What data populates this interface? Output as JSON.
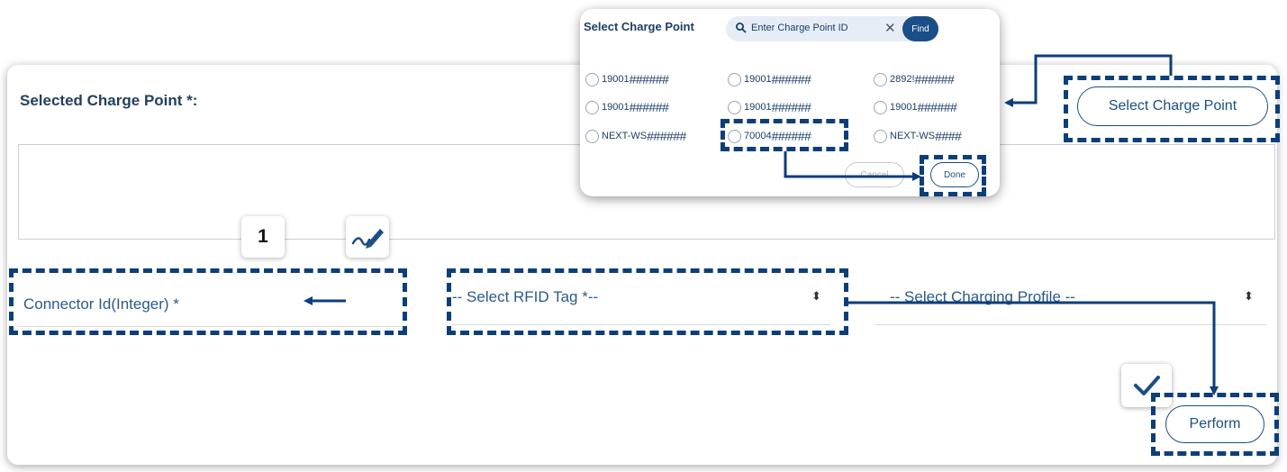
{
  "main": {
    "selected_label": "Selected Charge Point *:",
    "select_button": "Select Charge Point",
    "connector_label": "Connector Id(Integer) *",
    "connector_value": "1",
    "rfid_placeholder": "-- Select RFID Tag *--",
    "profile_placeholder": "-- Select Charging Profile --",
    "perform_button": "Perform",
    "select_arrows": "⬍"
  },
  "popup": {
    "title": "Select Charge Point",
    "search_placeholder": "Enter Charge Point ID",
    "clear_glyph": "✕",
    "find_button": "Find",
    "options": [
      {
        "prefix": "19001",
        "mask": "######"
      },
      {
        "prefix": "19001",
        "mask": "######"
      },
      {
        "prefix": "2892!",
        "mask": "######"
      },
      {
        "prefix": "19001",
        "mask": "######"
      },
      {
        "prefix": "19001",
        "mask": "######"
      },
      {
        "prefix": "19001",
        "mask": "######"
      },
      {
        "prefix": "NEXT-WS",
        "mask": "######"
      },
      {
        "prefix": "70004",
        "mask": "######"
      },
      {
        "prefix": "NEXT-WS",
        "mask": "####"
      }
    ],
    "cancel_button": "Cancel",
    "done_button": "Done"
  },
  "colors": {
    "accent": "#1b4e86",
    "annotation": "#0c3e7a",
    "label_text": "#2a5b88"
  }
}
